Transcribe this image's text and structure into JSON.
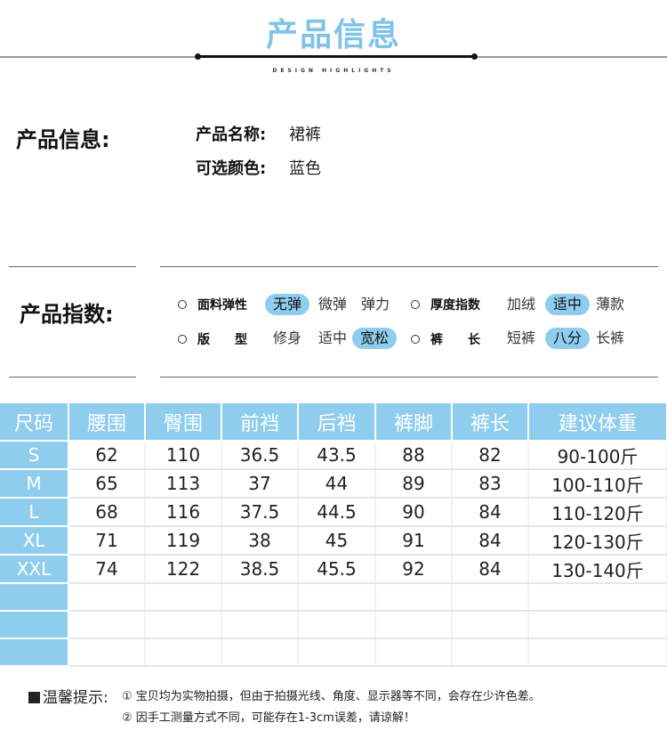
{
  "header": {
    "title": "产品信息",
    "subtitle": "DESIGN HIGHLIGHTS"
  },
  "info": {
    "heading": "产品信息:",
    "rows": [
      {
        "label": "产品名称:",
        "value": "裙裤"
      },
      {
        "label": "可选颜色:",
        "value": "蓝色"
      }
    ]
  },
  "index": {
    "heading": "产品指数:",
    "rows": [
      {
        "left": {
          "label": "面料弹性",
          "options": [
            "无弹",
            "微弹",
            "弹力"
          ],
          "selected": "无弹"
        },
        "right": {
          "label": "厚度指数",
          "options": [
            "加绒",
            "适中",
            "薄款"
          ],
          "selected": "适中"
        }
      },
      {
        "left": {
          "label": "版　　型",
          "options": [
            "修身",
            "适中",
            "宽松"
          ],
          "selected": "宽松"
        },
        "right": {
          "label": "裤　　长",
          "options": [
            "短裤",
            "八分",
            "长裤"
          ],
          "selected": "八分"
        }
      }
    ]
  },
  "size_table": {
    "headers": [
      "尺码",
      "腰围",
      "臀围",
      "前裆",
      "后裆",
      "裤脚",
      "裤长",
      "建议体重"
    ],
    "rows": [
      [
        "S",
        "62",
        "110",
        "36.5",
        "43.5",
        "88",
        "82",
        "90-100斤"
      ],
      [
        "M",
        "65",
        "113",
        "37",
        "44",
        "89",
        "83",
        "100-110斤"
      ],
      [
        "L",
        "68",
        "116",
        "37.5",
        "44.5",
        "90",
        "84",
        "110-120斤"
      ],
      [
        "XL",
        "71",
        "119",
        "38",
        "45",
        "91",
        "84",
        "120-130斤"
      ],
      [
        "XXL",
        "74",
        "122",
        "38.5",
        "45.5",
        "92",
        "84",
        "130-140斤"
      ]
    ]
  },
  "tips": {
    "label": "温馨提示:",
    "lines": [
      "① 宝贝均为实物拍摄，但由于拍摄光线、角度、显示器等不同，会存在少许色差。",
      "② 因手工测量方式不同，可能存在1-3cm误差，请谅解！"
    ]
  },
  "colors": {
    "accent": "#8fcdef",
    "title": "#7fc4e8"
  }
}
